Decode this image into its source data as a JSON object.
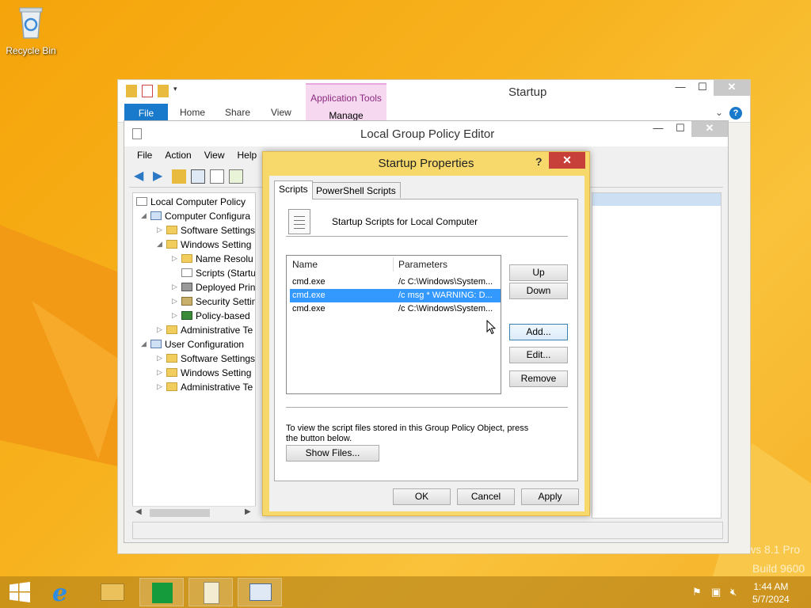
{
  "desktop": {
    "icons": [
      {
        "label": "Recycle Bin",
        "icon": "recycle-bin-icon"
      }
    ],
    "watermark": {
      "line1": "ws 8.1 Pro",
      "line2": "Build 9600"
    }
  },
  "explorer": {
    "title": "Startup",
    "context_group": "Application Tools",
    "tabs": [
      "File",
      "Home",
      "Share",
      "View",
      "Manage"
    ]
  },
  "gpedit": {
    "title": "Local Group Policy Editor",
    "menu": [
      "File",
      "Action",
      "View",
      "Help"
    ],
    "tree": [
      {
        "label": "Local Computer Policy",
        "level": 0
      },
      {
        "label": "Computer Configura",
        "level": 1
      },
      {
        "label": "Software Settings",
        "level": 2
      },
      {
        "label": "Windows Setting",
        "level": 2
      },
      {
        "label": "Name Resolu",
        "level": 3
      },
      {
        "label": "Scripts (Startu",
        "level": 3
      },
      {
        "label": "Deployed Prin",
        "level": 3
      },
      {
        "label": "Security Settin",
        "level": 3
      },
      {
        "label": "Policy-based",
        "level": 3
      },
      {
        "label": "Administrative Te",
        "level": 2
      },
      {
        "label": "User Configuration",
        "level": 1
      },
      {
        "label": "Software Settings",
        "level": 2
      },
      {
        "label": "Windows Setting",
        "level": 2
      },
      {
        "label": "Administrative Te",
        "level": 2
      }
    ]
  },
  "dialog": {
    "title": "Startup Properties",
    "help_glyph": "?",
    "close_glyph": "✕",
    "tabs": [
      "Scripts",
      "PowerShell Scripts"
    ],
    "header": "Startup Scripts for Local Computer",
    "columns": {
      "name": "Name",
      "params": "Parameters"
    },
    "rows": [
      {
        "name": "cmd.exe",
        "params": "/c C:\\Windows\\System...",
        "selected": false
      },
      {
        "name": "cmd.exe",
        "params": "/c msg * WARNING: D...",
        "selected": true
      },
      {
        "name": "cmd.exe",
        "params": "/c C:\\Windows\\System...",
        "selected": false
      }
    ],
    "buttons": {
      "up": "Up",
      "down": "Down",
      "add": "Add...",
      "edit": "Edit...",
      "remove": "Remove",
      "show_files": "Show Files...",
      "ok": "OK",
      "cancel": "Cancel",
      "apply": "Apply"
    },
    "hint": "To view the script files stored in this Group Policy Object, press the button below."
  },
  "taskbar": {
    "clock_time": "1:44 AM",
    "clock_date": "5/7/2024"
  },
  "colors": {
    "accent": "#1979ca",
    "selection": "#3399ff",
    "dialog_frame": "#f7d96b",
    "close_red": "#c7413a"
  }
}
